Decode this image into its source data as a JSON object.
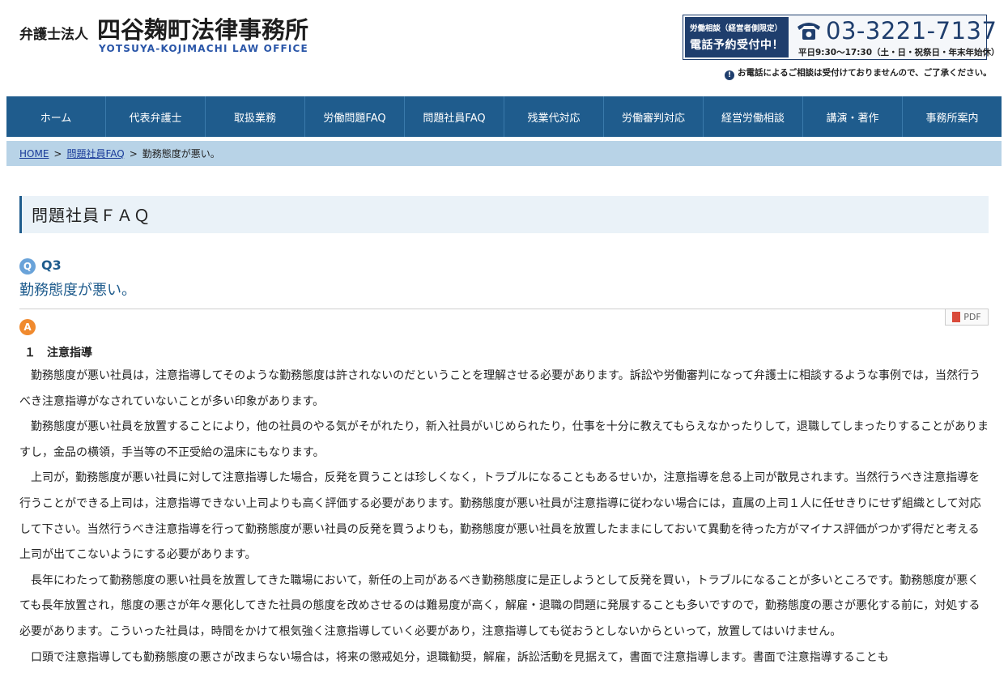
{
  "header": {
    "logo_prefix": "弁護士法人",
    "logo_main": "四谷麹町法律事務所",
    "logo_en": "YOTSUYA-KOJIMACHI LAW OFFICE",
    "phone_badge_line1": "労働相談（経営者側限定）",
    "phone_badge_line2": "電話予約受付中！",
    "phone_number": "03-3221-7137",
    "phone_hours": "平日9:30〜17:30（土・日・祝祭日・年末年始休）",
    "phone_note": "お電話によるご相談は受付けておりませんので、ご了承ください。"
  },
  "nav": {
    "items": [
      {
        "label": "ホーム"
      },
      {
        "label": "代表弁護士"
      },
      {
        "label": "取扱業務"
      },
      {
        "label": "労働問題FAQ"
      },
      {
        "label": "問題社員FAQ"
      },
      {
        "label": "残業代対応"
      },
      {
        "label": "労働審判対応"
      },
      {
        "label": "経営労働相談"
      },
      {
        "label": "講演・著作"
      },
      {
        "label": "事務所案内"
      }
    ]
  },
  "breadcrumb": {
    "home": "HOME",
    "sep": ">",
    "category": "問題社員FAQ",
    "current": "勤務態度が悪い。"
  },
  "page": {
    "section_title": "問題社員ＦＡＱ",
    "q_icon": "Q",
    "q_number": "Q3",
    "question": "勤務態度が悪い。",
    "pdf_label": "PDF",
    "a_icon": "A",
    "answer_heading": "１　注意指導",
    "paragraphs": [
      "勤務態度が悪い社員は，注意指導してそのような勤務態度は許されないのだということを理解させる必要があります。訴訟や労働審判になって弁護士に相談するような事例では，当然行うべき注意指導がなされていないことが多い印象があります。",
      "勤務態度が悪い社員を放置することにより，他の社員のやる気がそがれたり，新入社員がいじめられたり，仕事を十分に教えてもらえなかったりして，退職してしまったりすることがありますし，金品の横領，手当等の不正受給の温床にもなります。",
      "上司が，勤務態度が悪い社員に対して注意指導した場合，反発を買うことは珍しくなく，トラブルになることもあるせいか，注意指導を怠る上司が散見されます。当然行うべき注意指導を行うことができる上司は，注意指導できない上司よりも高く評価する必要があります。勤務態度が悪い社員が注意指導に従わない場合には，直属の上司１人に任せきりにせず組織として対応して下さい。当然行うべき注意指導を行って勤務態度が悪い社員の反発を買うよりも，勤務態度が悪い社員を放置したままにしておいて異動を待った方がマイナス評価がつかず得だと考える上司が出てこないようにする必要があります。",
      "長年にわたって勤務態度の悪い社員を放置してきた職場において，新任の上司があるべき勤務態度に是正しようとして反発を買い，トラブルになることが多いところです。勤務態度が悪くても長年放置され，態度の悪さが年々悪化してきた社員の態度を改めさせるのは難易度が高く，解雇・退職の問題に発展することも多いですので，勤務態度の悪さが悪化する前に，対処する必要があります。こういった社員は，時間をかけて根気強く注意指導していく必要があり，注意指導しても従おうとしないからといって，放置してはいけません。",
      "口頭で注意指導しても勤務態度の悪さが改まらない場合は，将来の懲戒処分，退職勧奨，解雇，訴訟活動を見据えて，書面で注意指導します。書面で注意指導することも"
    ]
  },
  "colors": {
    "nav_bg": "#1f5c8d",
    "breadcrumb_bg": "#b8d3e7",
    "title_bg": "#eaf2f8",
    "accent_blue": "#1f5c8d",
    "link": "#1a3c9a"
  }
}
